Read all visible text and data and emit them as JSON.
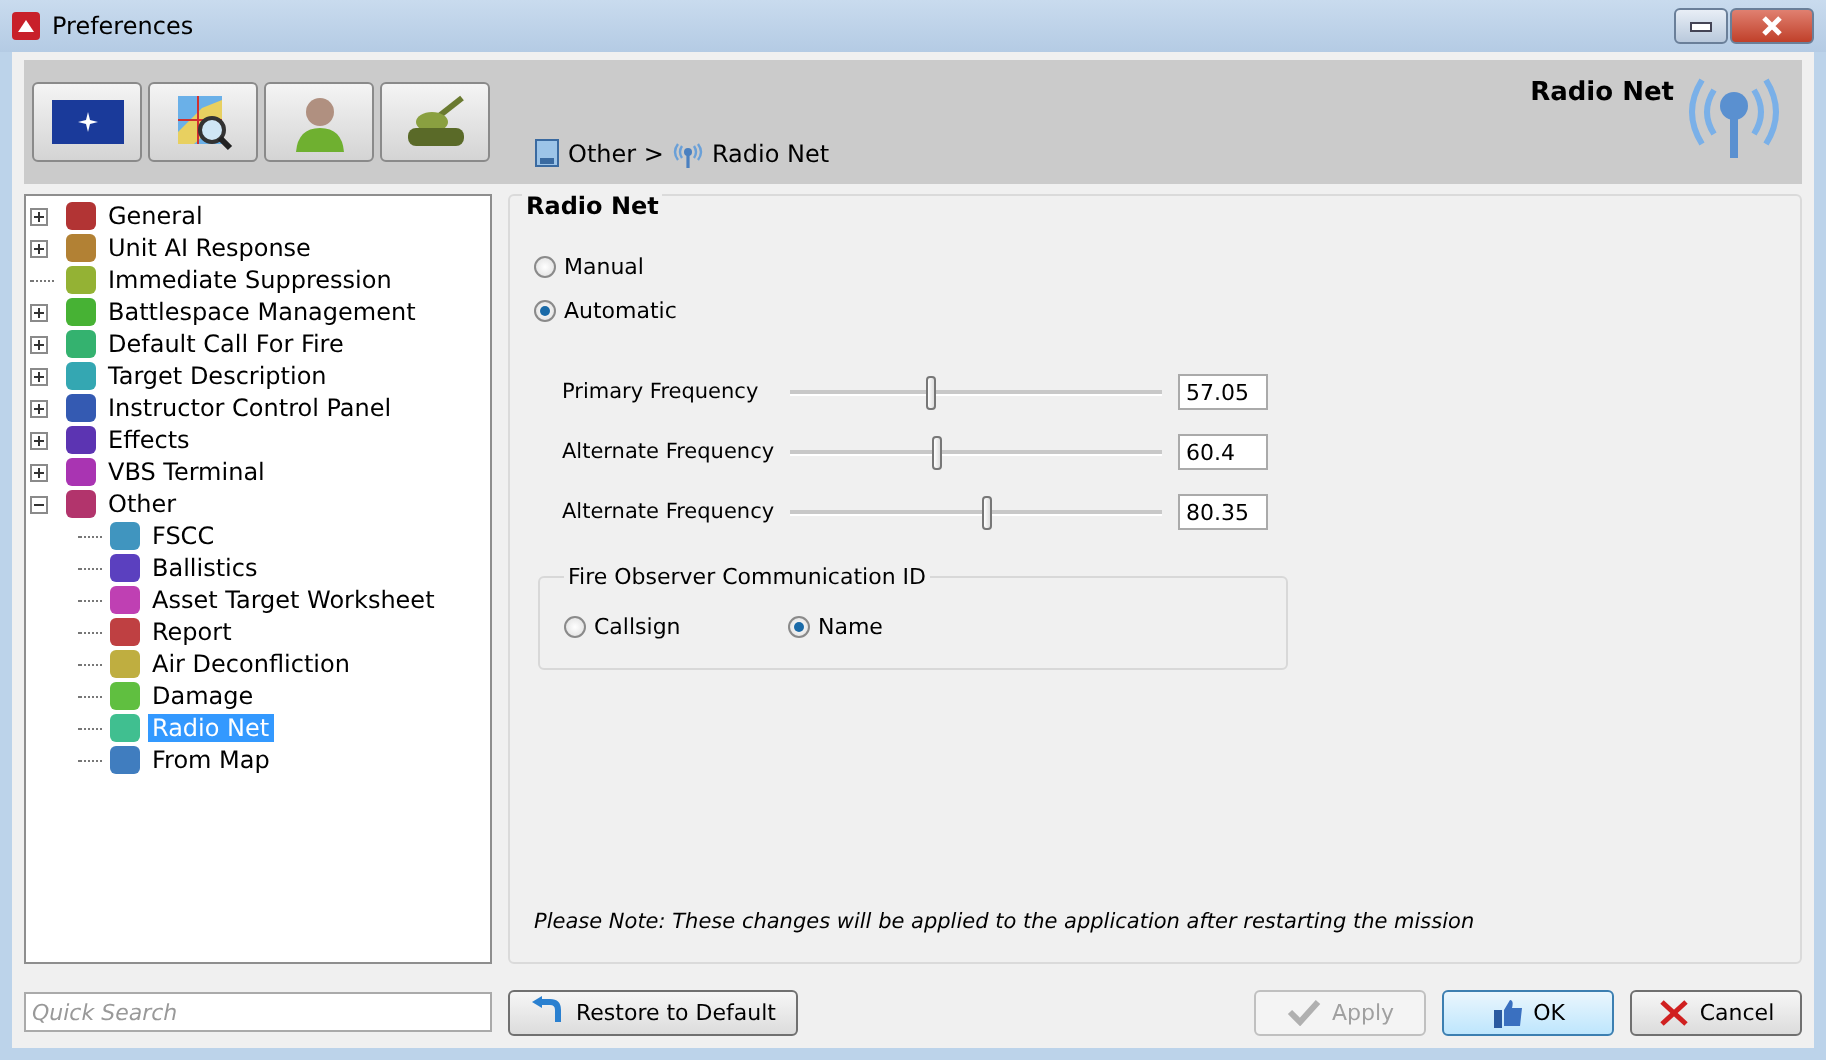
{
  "window": {
    "title": "Preferences"
  },
  "header": {
    "title": "Radio Net",
    "breadcrumb": [
      "Other >",
      "Radio Net"
    ]
  },
  "tree": [
    {
      "label": "General",
      "kind": "group",
      "expanded": false,
      "selected": false
    },
    {
      "label": "Unit AI Response",
      "kind": "group",
      "expanded": false,
      "selected": false
    },
    {
      "label": "Immediate Suppression",
      "kind": "leaf",
      "selected": false
    },
    {
      "label": "Battlespace Management",
      "kind": "group",
      "expanded": false,
      "selected": false
    },
    {
      "label": "Default Call For Fire",
      "kind": "group",
      "expanded": false,
      "selected": false
    },
    {
      "label": "Target Description",
      "kind": "group",
      "expanded": false,
      "selected": false
    },
    {
      "label": "Instructor Control Panel",
      "kind": "group",
      "expanded": false,
      "selected": false
    },
    {
      "label": "Effects",
      "kind": "group",
      "expanded": false,
      "selected": false
    },
    {
      "label": "VBS Terminal",
      "kind": "group",
      "expanded": false,
      "selected": false
    },
    {
      "label": "Other",
      "kind": "group",
      "expanded": true,
      "selected": false,
      "children": [
        {
          "label": "FSCC",
          "selected": false
        },
        {
          "label": "Ballistics",
          "selected": false
        },
        {
          "label": "Asset Target Worksheet",
          "selected": false
        },
        {
          "label": "Report",
          "selected": false
        },
        {
          "label": "Air Deconfliction",
          "selected": false
        },
        {
          "label": "Damage",
          "selected": false
        },
        {
          "label": "Radio Net",
          "selected": true
        },
        {
          "label": "From Map",
          "selected": false
        }
      ]
    }
  ],
  "panel": {
    "title": "Radio Net",
    "mode": [
      {
        "label": "Manual",
        "selected": false
      },
      {
        "label": "Automatic",
        "selected": true
      }
    ],
    "sliders": [
      {
        "label": "Primary Frequency",
        "level": 0.38,
        "value": "57.05"
      },
      {
        "label": "Alternate Frequency",
        "level": 0.4,
        "value": "60.4"
      },
      {
        "label": "Alternate Frequency",
        "level": 0.53,
        "value": "80.35"
      }
    ],
    "id_group": {
      "title": "Fire Observer Communication ID",
      "options": [
        {
          "label": "Callsign",
          "selected": false
        },
        {
          "label": "Name",
          "selected": true
        }
      ]
    },
    "note": "Please Note: These changes will be applied to the application after restarting the mission"
  },
  "search": {
    "placeholder": "Quick Search"
  },
  "restore_button": "Restore to Default",
  "buttons": [
    {
      "label": "Apply",
      "kind": "apply",
      "disabled": true,
      "default": false
    },
    {
      "label": "OK",
      "kind": "ok",
      "disabled": false,
      "default": true
    },
    {
      "label": "Cancel",
      "kind": "cancel",
      "disabled": false,
      "default": false
    }
  ]
}
